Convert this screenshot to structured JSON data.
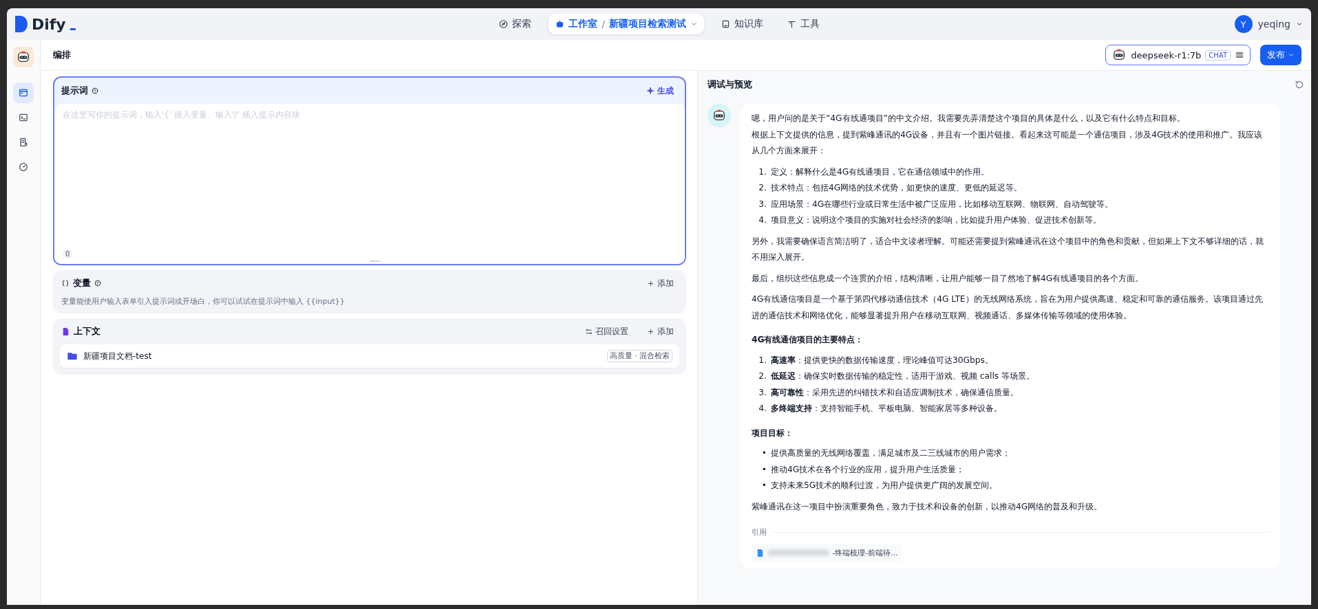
{
  "nav": {
    "logo": "Dify",
    "items": [
      {
        "kind": "link",
        "label": "探索",
        "selected": false
      },
      {
        "kind": "studio",
        "label": "工作室",
        "separator": "/",
        "sub": "新疆项目检索测试",
        "selected": true
      },
      {
        "kind": "link",
        "label": "知识库",
        "selected": false
      },
      {
        "kind": "link",
        "label": "工具",
        "selected": false
      }
    ],
    "user": {
      "initial": "Y",
      "name": "yeqing"
    }
  },
  "sidebar": {
    "items": [
      {
        "selected": true
      },
      {
        "selected": false
      },
      {
        "selected": false
      },
      {
        "selected": false
      }
    ]
  },
  "header": {
    "title": "编排",
    "model": "deepseek-r1:7b",
    "model_tag": "CHAT",
    "publish": "发布"
  },
  "prompt": {
    "title": "提示词",
    "generate": "生成",
    "placeholder": "在这里写你的提示词，输入'{' 插入变量、输入'/' 插入提示内容块",
    "count": "0"
  },
  "variables": {
    "title": "变量",
    "add": "添加",
    "hint": "变量能使用户输入表单引入提示词或开场白，你可以试试在提示词中输入 {{input}}"
  },
  "context": {
    "title": "上下文",
    "recall": "召回设置",
    "add": "添加",
    "docs": [
      {
        "name": "新疆项目文档-test",
        "tag": "高质量 · 混合检索"
      }
    ]
  },
  "preview": {
    "title": "调试与预览",
    "blocks": [
      {
        "kind": "paragraph",
        "lines": [
          "嗯，用户问的是关于“4G有线通项目”的中文介绍。我需要先弄清楚这个项目的具体是什么，以及它有什么特点和目标。",
          "根据上下文提供的信息，提到紫峰通讯的4G设备，并且有一个图片链接。看起来这可能是一个通信项目，涉及4G技术的使用和推广。我应该从几个方面来展开："
        ]
      },
      {
        "kind": "list",
        "items": [
          {
            "marker": "1.",
            "text": "定义：解释什么是4G有线通项目，它在通信领域中的作用。"
          },
          {
            "marker": "2.",
            "text": "技术特点：包括4G网络的技术优势，如更快的速度、更低的延迟等。"
          },
          {
            "marker": "3.",
            "text": "应用场景：4G在哪些行业或日常生活中被广泛应用，比如移动互联网、物联网、自动驾驶等。"
          },
          {
            "marker": "4.",
            "text": "项目意义：说明这个项目的实施对社会经济的影响，比如提升用户体验、促进技术创新等。"
          }
        ]
      },
      {
        "kind": "paragraph",
        "lines": [
          "另外，我需要确保语言简洁明了，适合中文读者理解。可能还需要提到紫峰通讯在这个项目中的角色和贡献，但如果上下文不够详细的话，就不用深入展开。"
        ]
      },
      {
        "kind": "paragraph",
        "lines": [
          "最后，组织这些信息成一个连贯的介绍，结构清晰，让用户能够一目了然地了解4G有线通项目的各个方面。"
        ]
      },
      {
        "kind": "paragraph",
        "lines": [
          "4G有线通信项目是一个基于第四代移动通信技术（4G LTE）的无线网络系统，旨在为用户提供高速、稳定和可靠的通信服务。该项目通过先进的通信技术和网络优化，能够显著提升用户在移动互联网、视频通话、多媒体传输等领域的使用体验。"
        ]
      },
      {
        "kind": "heading",
        "text": "4G有线通信项目的主要特点："
      },
      {
        "kind": "list",
        "items": [
          {
            "marker": "1.",
            "text": "**高速率**：提供更快的数据传输速度，理论峰值可达30Gbps。"
          },
          {
            "marker": "2.",
            "text": "**低延迟**：确保实时数据传输的稳定性，适用于游戏、视频 calls 等场景。"
          },
          {
            "marker": "3.",
            "text": "**高可靠性**：采用先进的纠错技术和自适应调制技术，确保通信质量。"
          },
          {
            "marker": "4.",
            "text": "**多终端支持**：支持智能手机、平板电脑、智能家居等多种设备。"
          }
        ]
      },
      {
        "kind": "heading",
        "text": "项目目标："
      },
      {
        "kind": "list",
        "items": [
          {
            "marker": "•",
            "text": "提供高质量的无线网络覆盖，满足城市及二三线城市的用户需求；"
          },
          {
            "marker": "•",
            "text": "推动4G技术在各个行业的应用，提升用户生活质量；"
          },
          {
            "marker": "•",
            "text": "支持未来5G技术的顺利过渡，为用户提供更广阔的发展空间。"
          }
        ]
      },
      {
        "kind": "paragraph",
        "lines": [
          "紫峰通讯在这一项目中扮演重要角色，致力于技术和设备的创新，以推动4G网络的普及和升级。"
        ]
      }
    ],
    "citation_label": "引用",
    "citations": [
      {
        "text": "-终端梳理-前端待..."
      }
    ]
  }
}
